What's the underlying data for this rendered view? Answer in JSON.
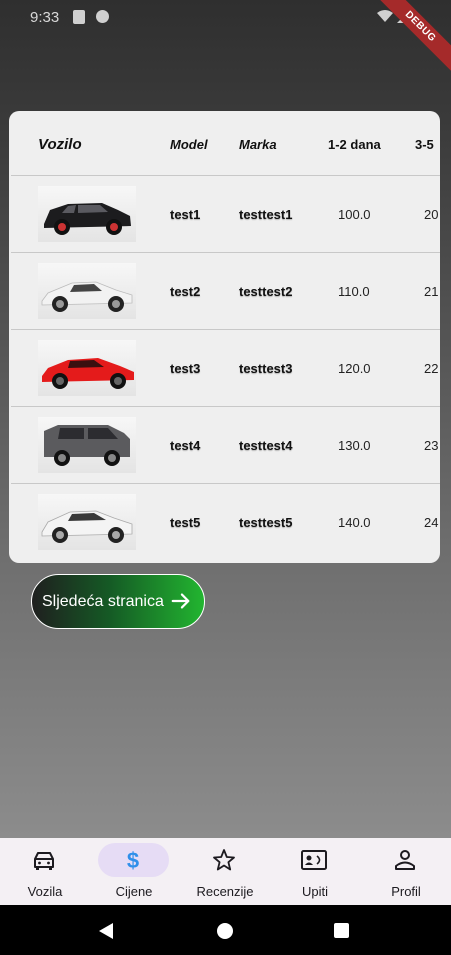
{
  "status_bar": {
    "time": "9:33",
    "debug_label": "DEBUG"
  },
  "table": {
    "headers": {
      "vehicle": "Vozilo",
      "model": "Model",
      "brand": "Marka",
      "price_1_2": "1-2 dana",
      "price_3_5": "3-5"
    },
    "rows": [
      {
        "image": "car-suv-black",
        "model": "test1",
        "brand": "testtest1",
        "price_1_2": "100.0",
        "price_3_5": "20"
      },
      {
        "image": "car-sports-white",
        "model": "test2",
        "brand": "testtest2",
        "price_1_2": "110.0",
        "price_3_5": "21"
      },
      {
        "image": "car-coupe-red",
        "model": "test3",
        "brand": "testtest3",
        "price_1_2": "120.0",
        "price_3_5": "22"
      },
      {
        "image": "car-offroad-grey",
        "model": "test4",
        "brand": "testtest4",
        "price_1_2": "130.0",
        "price_3_5": "23"
      },
      {
        "image": "car-sedan-white",
        "model": "test5",
        "brand": "testtest5",
        "price_1_2": "140.0",
        "price_3_5": "24"
      }
    ]
  },
  "next_button": {
    "label": "Sljedeća stranica",
    "icon": "arrow-right-icon"
  },
  "bottom_nav": {
    "active": "Cijene",
    "items": [
      {
        "label": "Vozila",
        "icon": "car-icon"
      },
      {
        "label": "Cijene",
        "icon": "dollar-icon"
      },
      {
        "label": "Recenzije",
        "icon": "star-icon"
      },
      {
        "label": "Upiti",
        "icon": "contact-card-icon"
      },
      {
        "label": "Profil",
        "icon": "person-icon"
      }
    ]
  },
  "colors": {
    "active_nav": "#e6dcf5",
    "active_icon": "#2f8fea",
    "button_green": "#22b530"
  }
}
